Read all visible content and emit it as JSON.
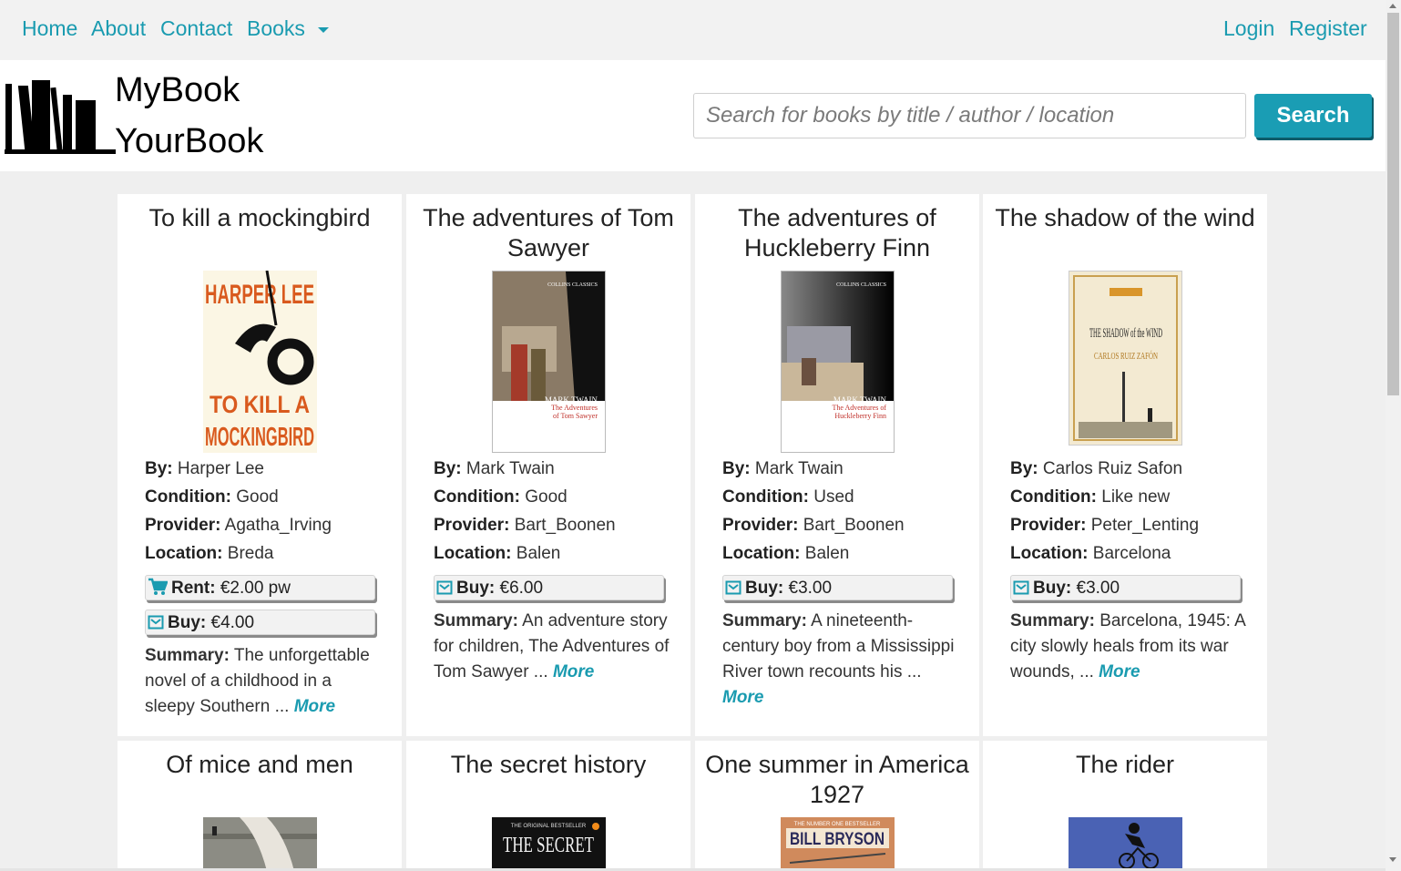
{
  "nav": {
    "home": "Home",
    "about": "About",
    "contact": "Contact",
    "books": "Books",
    "login": "Login",
    "register": "Register"
  },
  "brand": {
    "line1": "MyBook",
    "line2": "YourBook"
  },
  "search": {
    "placeholder": "Search for books by title / author / location",
    "button": "Search"
  },
  "labels": {
    "by": "By:",
    "condition": "Condition:",
    "provider": "Provider:",
    "location": "Location:",
    "rent": "Rent:",
    "buy": "Buy:",
    "summary": "Summary:",
    "more": "More"
  },
  "books": [
    {
      "title": "To kill a mockingbird",
      "author": "Harper Lee",
      "condition": "Good",
      "provider": "Agatha_Irving",
      "location": "Breda",
      "rent": "€2.00 pw",
      "buy": "€4.00",
      "summary": "The unforgettable novel of a childhood in a sleepy Southern ...",
      "cover": {
        "top_text": "HARPER LEE",
        "bottom_text": "TO KILL A MOCKINGBIRD"
      }
    },
    {
      "title": "The adventures of Tom Sawyer",
      "author": "Mark Twain",
      "condition": "Good",
      "provider": "Bart_Boonen",
      "location": "Balen",
      "buy": "€6.00",
      "summary": "An adventure story for children, The Adventures of Tom Sawyer ...",
      "cover": {
        "series": "COLLINS CLASSICS",
        "author": "MARK TWAIN",
        "title": "The Adventures of Tom Sawyer"
      }
    },
    {
      "title": "The adventures of Huckleberry Finn",
      "author": "Mark Twain",
      "condition": "Used",
      "provider": "Bart_Boonen",
      "location": "Balen",
      "buy": "€3.00",
      "summary": "A nineteenth-century boy from a Mississippi River town recounts his ...",
      "cover": {
        "series": "COLLINS CLASSICS",
        "author": "MARK TWAIN",
        "title": "The Adventures of Huckleberry Finn"
      }
    },
    {
      "title": "The shadow of the wind",
      "author": "Carlos Ruiz Safon",
      "condition": "Like new",
      "provider": "Peter_Lenting",
      "location": "Barcelona",
      "buy": "€3.00",
      "summary": "Barcelona, 1945: A city slowly heals from its war wounds, ...",
      "cover": {
        "title": "THE SHADOW of the WIND",
        "author": "CARLOS RUIZ ZAFÓN"
      }
    },
    {
      "title": "Of mice and men"
    },
    {
      "title": "The secret history",
      "cover": {
        "top": "THE ORIGINAL BESTSELLER",
        "title": "THE SECRET"
      }
    },
    {
      "title": "One summer in America 1927",
      "cover": {
        "top": "THE NUMBER ONE BESTSELLER",
        "author": "BILL BRYSON"
      }
    },
    {
      "title": "The rider"
    }
  ],
  "colors": {
    "accent": "#1a9bb0",
    "button": "#1a9db4",
    "page_bg": "#efefef",
    "nav_bg": "#f2f2f2"
  }
}
